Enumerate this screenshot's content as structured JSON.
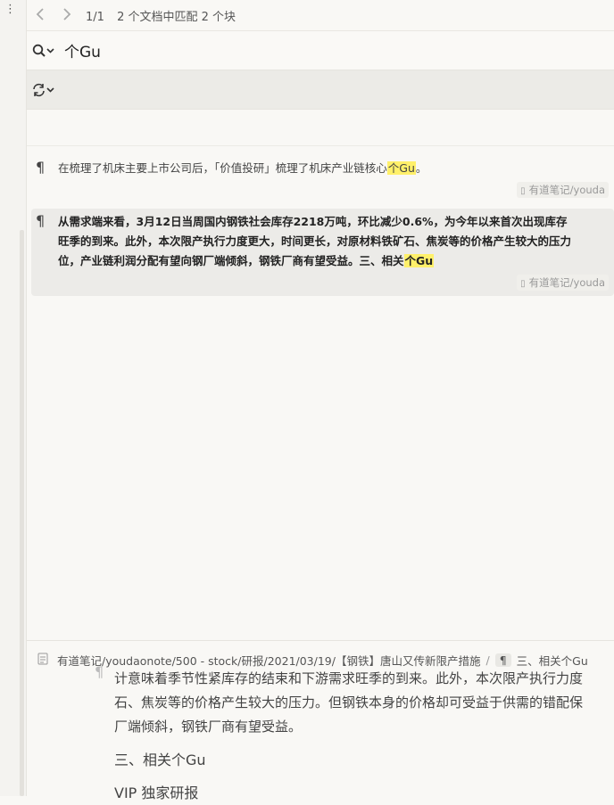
{
  "nav": {
    "prev": "‹",
    "next": "›"
  },
  "counter": {
    "page": "1/1",
    "summary": "2 个文档中匹配 2 个块"
  },
  "search": {
    "query": "个Gu"
  },
  "results": [
    {
      "before": "在梳理了机床主要上市公司后，「价值投研」梳理了机床产业链核心",
      "match": "个Gu",
      "after": "。",
      "path": "有道笔记/youda"
    },
    {
      "line1": "从需求端来看，3月12日当周国内钢铁社会库存2218万吨，环比减少0.6%，为今年以来首次出现库存",
      "line2": "旺季的到来。此外，本次限产执行力度更大，时间更长，对原材料铁矿石、焦炭等的价格产生较大的压力",
      "line3_before": "位，产业链利润分配有望向钢厂端倾斜，钢铁厂商有望受益。三、相关",
      "match": "个Gu",
      "path": "有道笔记/youda"
    }
  ],
  "breadcrumb": {
    "path": "有道笔记/youdaonote/500 - stock/研报/2021/03/19/【钢铁】唐山又传新限产措施",
    "sep": "/",
    "pilcrow": "¶",
    "block": "三、相关个Gu"
  },
  "preview": {
    "line0": "计意味着季节性紧库存的结束和下游需求旺季的到来。此外，本次限产执行力度",
    "line1": "石、焦炭等的价格产生较大的压力。但钢铁本身的价格却可受益于供需的错配保",
    "line2": "厂端倾斜，钢铁厂商有望受益。",
    "heading": "三、相关个Gu",
    "next": "VIP 独家研报"
  },
  "icons": {
    "menu": "more-vertical-icon",
    "search": "search-icon",
    "replace": "replace-icon",
    "pilcrow": "¶",
    "doc": "document-icon"
  }
}
